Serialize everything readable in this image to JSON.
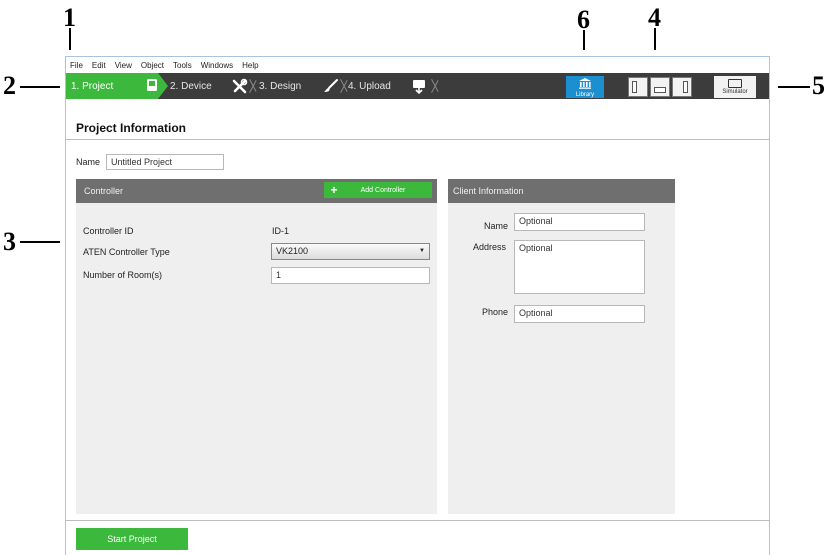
{
  "callouts": {
    "c1": "1",
    "c2": "2",
    "c3": "3",
    "c4": "4",
    "c5": "5",
    "c6": "6"
  },
  "menu": [
    "File",
    "Edit",
    "View",
    "Object",
    "Tools",
    "Windows",
    "Help"
  ],
  "steps": [
    {
      "label": "1. Project",
      "icon": "device-icon",
      "active": true
    },
    {
      "label": "2. Device",
      "icon": "tools-icon",
      "active": false
    },
    {
      "label": "3. Design",
      "icon": "brush-icon",
      "active": false
    },
    {
      "label": "4. Upload",
      "icon": "upload-icon",
      "active": false
    }
  ],
  "toolbar": {
    "library_label": "Library",
    "library_icon": "library-icon",
    "simulator_label": "Simulator",
    "simulator_icon": "monitor-icon",
    "layout_icons": [
      "layout-left-panel-icon",
      "layout-bottom-panel-icon",
      "layout-right-panel-icon"
    ]
  },
  "page": {
    "title": "Project Information",
    "name_label": "Name",
    "name_value": "Untitled Project"
  },
  "controller": {
    "header": "Controller",
    "add_button": "Add Controller",
    "id_label": "Controller ID",
    "id_value": "ID-1",
    "type_label": "ATEN Controller Type",
    "type_value": "VK2100",
    "rooms_label": "Number of Room(s)",
    "rooms_value": "1"
  },
  "client": {
    "header": "Client Information",
    "name_label": "Name",
    "name_placeholder": "Optional",
    "address_label": "Address",
    "address_placeholder": "Optional",
    "phone_label": "Phone",
    "phone_placeholder": "Optional"
  },
  "footer": {
    "start_button": "Start Project"
  },
  "colors": {
    "accent_green": "#3cb83c",
    "library_blue": "#1b8fd0",
    "toolbar_dark": "#3c3c3c",
    "panel_header": "#6f6f6f"
  }
}
